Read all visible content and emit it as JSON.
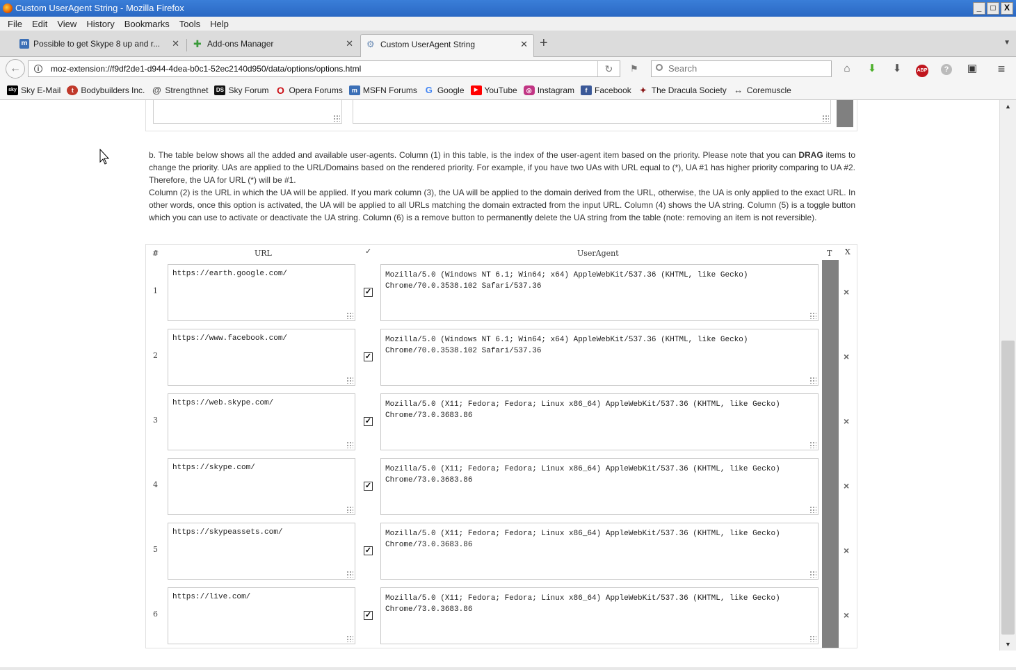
{
  "window": {
    "title": "Custom UserAgent String - Mozilla Firefox",
    "controls": [
      "_",
      "□",
      "X"
    ]
  },
  "menu": [
    "File",
    "Edit",
    "View",
    "History",
    "Bookmarks",
    "Tools",
    "Help"
  ],
  "tabs": [
    {
      "label": "Possible to get Skype 8 up and r...",
      "icon": "msfn-icon",
      "active": false
    },
    {
      "label": "Add-ons Manager",
      "icon": "puzzle-icon",
      "active": false
    },
    {
      "label": "Custom UserAgent String",
      "icon": "extension-gear-icon",
      "active": true
    }
  ],
  "navbar": {
    "url": "moz-extension://f9df2de1-d944-4dea-b0c1-52ec2140d950/data/options/options.html",
    "search_placeholder": "Search"
  },
  "bookmarks": [
    {
      "label": "Sky E-Mail",
      "icon": "sky-icon",
      "color": "#000000",
      "glyph": "sky"
    },
    {
      "label": "Bodybuilders Inc.",
      "icon": "t-icon",
      "color": "#c0392b",
      "glyph": "t"
    },
    {
      "label": "Strengthnet",
      "icon": "spiral-icon",
      "color": "#555555",
      "glyph": "@"
    },
    {
      "label": "Sky Forum",
      "icon": "ds-icon",
      "color": "#111111",
      "glyph": "DS"
    },
    {
      "label": "Opera Forums",
      "icon": "opera-icon",
      "color": "#cc0f16",
      "glyph": "O"
    },
    {
      "label": "MSFN Forums",
      "icon": "msfn-icon",
      "color": "#3b6fb6",
      "glyph": "m"
    },
    {
      "label": "Google",
      "icon": "google-icon",
      "color": "#4285f4",
      "glyph": "G"
    },
    {
      "label": "YouTube",
      "icon": "youtube-icon",
      "color": "#ff0000",
      "glyph": "▶"
    },
    {
      "label": "Instagram",
      "icon": "instagram-icon",
      "color": "#c13584",
      "glyph": "◎"
    },
    {
      "label": "Facebook",
      "icon": "facebook-icon",
      "color": "#3b5998",
      "glyph": "f"
    },
    {
      "label": "The Dracula Society",
      "icon": "bat-icon",
      "color": "#8b1a1a",
      "glyph": "✦"
    },
    {
      "label": "Coremuscle",
      "icon": "arrows-icon",
      "color": "#444444",
      "glyph": "↔"
    }
  ],
  "description": {
    "para1_pre": "b. The table below shows all the added and available user-agents. Column (1) in this table, is the index of the user-agent item based on the priority. Please note that you can ",
    "para1_bold": "DRAG",
    "para1_post": " items to change the priority. UAs are applied to the URL/Domains based on the rendered priority. For example, if you have two UAs with URL equal to (*), UA #1 has higher priority comparing to UA #2. Therefore, the UA for URL (*) will be #1.",
    "para2": "Column (2) is the URL in which the UA will be applied. If you mark column (3), the UA will be applied to the domain derived from the URL, otherwise, the UA is only applied to the exact URL. In other words, once this option is activated, the UA will be applied to all URLs matching the domain extracted from the input URL. Column (4) shows the UA string. Column (5) is a toggle button which you can use to activate or deactivate the UA string. Column (6) is a remove button to permanently delete the UA string from the table (note: removing an item is not reversible)."
  },
  "table": {
    "headers": {
      "index": "#",
      "url": "URL",
      "domain": "✓",
      "useragent": "UserAgent",
      "toggle": "T",
      "remove": "X"
    },
    "rows": [
      {
        "index": "1",
        "url": "https://earth.google.com/",
        "domain": true,
        "ua": "Mozilla/5.0 (Windows NT 6.1; Win64; x64) AppleWebKit/537.36 (KHTML, like Gecko) Chrome/70.0.3538.102 Safari/537.36"
      },
      {
        "index": "2",
        "url": "https://www.facebook.com/",
        "domain": true,
        "ua": "Mozilla/5.0 (Windows NT 6.1; Win64; x64) AppleWebKit/537.36 (KHTML, like Gecko) Chrome/70.0.3538.102 Safari/537.36"
      },
      {
        "index": "3",
        "url": "https://web.skype.com/",
        "domain": true,
        "ua": "Mozilla/5.0 (X11; Fedora; Fedora; Linux x86_64) AppleWebKit/537.36 (KHTML, like Gecko) Chrome/73.0.3683.86"
      },
      {
        "index": "4",
        "url": "https://skype.com/",
        "domain": true,
        "ua": "Mozilla/5.0 (X11; Fedora; Fedora; Linux x86_64) AppleWebKit/537.36 (KHTML, like Gecko) Chrome/73.0.3683.86"
      },
      {
        "index": "5",
        "url": "https://skypeassets.com/",
        "domain": true,
        "ua": "Mozilla/5.0 (X11; Fedora; Fedora; Linux x86_64) AppleWebKit/537.36 (KHTML, like Gecko) Chrome/73.0.3683.86"
      },
      {
        "index": "6",
        "url": "https://live.com/",
        "domain": true,
        "ua": "Mozilla/5.0 (X11; Fedora; Fedora; Linux x86_64) AppleWebKit/537.36 (KHTML, like Gecko) Chrome/73.0.3683.86"
      }
    ],
    "check_glyph": "✓",
    "remove_glyph": "×"
  },
  "colors": {
    "toggle_bar": "#808080",
    "titlebar": "#2a68c3"
  }
}
